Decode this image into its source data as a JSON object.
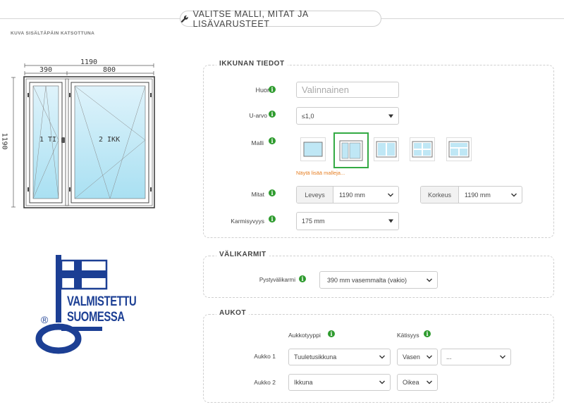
{
  "header": {
    "title": "VALITSE MALLI, MITAT JA LISÄVARUSTEET",
    "subtitle": "KUVA SISÄLTÄPÄIN KATSOTTUNA"
  },
  "drawing": {
    "total_width": "1190",
    "left_width": "390",
    "right_width": "800",
    "height": "1190",
    "left_pane_label": "1 TI",
    "right_pane_label": "2 IKK"
  },
  "logo": {
    "line1": "VALMISTETTU",
    "line2": "SUOMESSA",
    "registered": "®",
    "flag_color": "#1c3f94"
  },
  "ikkunan_tiedot": {
    "title": "IKKUNAN TIEDOT",
    "huone_label": "Huone",
    "huone_placeholder": "Valinnainen",
    "uarvo_label": "U-arvo",
    "uarvo_value": "≤1,0",
    "malli_label": "Malli",
    "more_models": "Näytä lisää malleja...",
    "mitat_label": "Mitat",
    "leveys_label": "Leveys",
    "leveys_value": "1190 mm",
    "korkeus_label": "Korkeus",
    "korkeus_value": "1190 mm",
    "karmisyvyys_label": "Karmisyvyys",
    "karmisyvyys_value": "175 mm"
  },
  "valikarmit": {
    "title": "VÄLIKARMIT",
    "pysty_label": "Pystyvälikarmi",
    "pysty_value": "390 mm vasemmalta (vakio)"
  },
  "aukot": {
    "title": "AUKOT",
    "col_type": "Aukkotyyppi",
    "col_hand": "Kätisyys",
    "rows": [
      {
        "label": "Aukko 1",
        "type": "Tuuletusikkuna",
        "hand": "Vasen",
        "extra": "..."
      },
      {
        "label": "Aukko 2",
        "type": "Ikkuna",
        "hand": "Oikea"
      }
    ]
  },
  "colors": {
    "accent_green": "#33aa44",
    "link_orange": "#e67e22",
    "info_green": "#2e9b2e"
  }
}
